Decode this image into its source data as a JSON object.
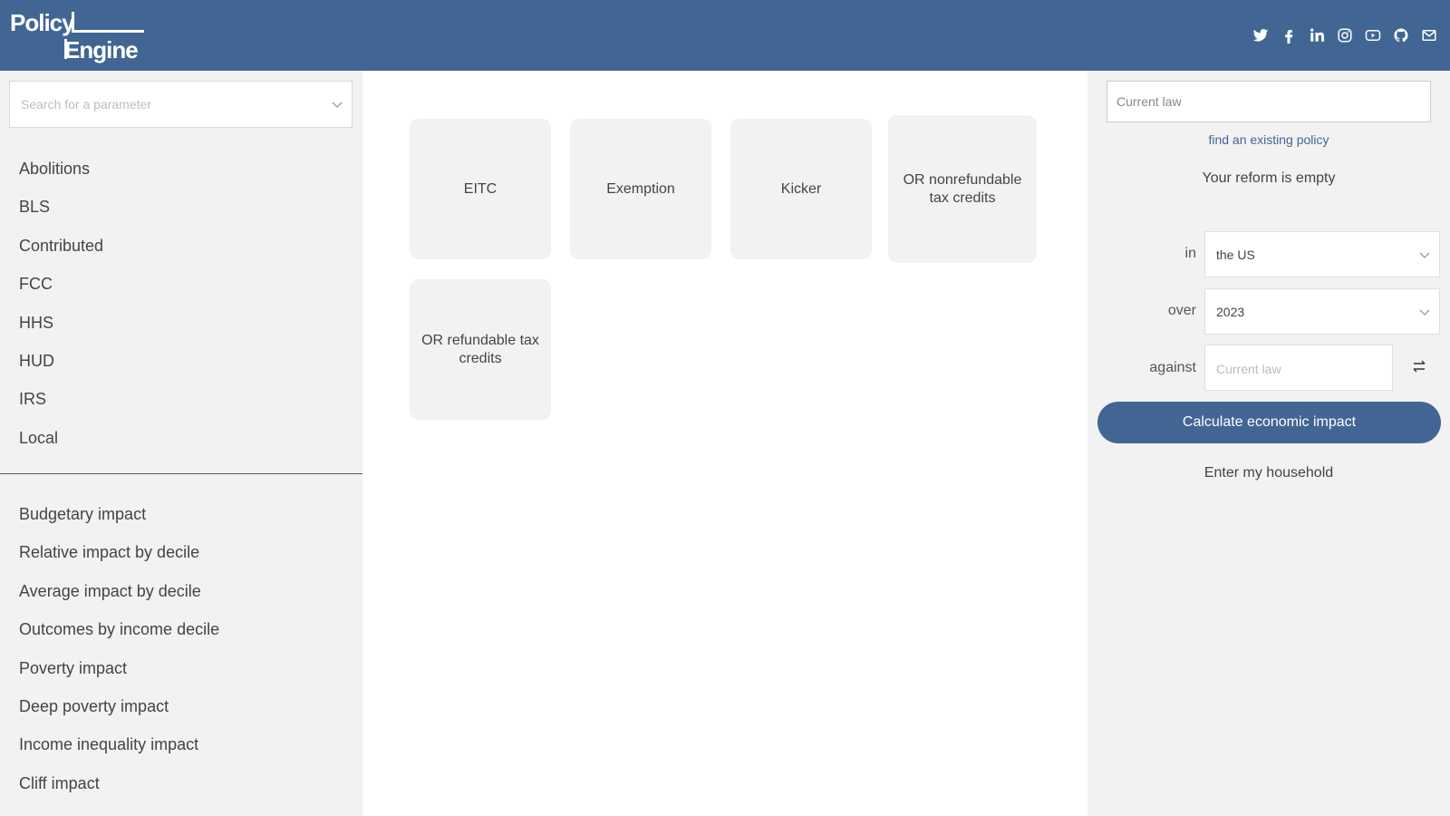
{
  "header": {
    "logo_line1": "Policy",
    "logo_line2": "Engine",
    "social_icons": [
      "twitter-icon",
      "facebook-icon",
      "linkedin-icon",
      "instagram-icon",
      "youtube-icon",
      "github-icon",
      "mail-icon"
    ],
    "background_color": "#426693"
  },
  "sidebar": {
    "search_placeholder": "Search for a parameter",
    "parameter_groups": [
      "Abolitions",
      "BLS",
      "Contributed",
      "FCC",
      "HHS",
      "HUD",
      "IRS",
      "Local"
    ],
    "outputs": [
      "Budgetary impact",
      "Relative impact by decile",
      "Average impact by decile",
      "Outcomes by income decile",
      "Poverty impact",
      "Deep poverty impact",
      "Income inequality impact",
      "Cliff impact"
    ]
  },
  "main": {
    "cards": [
      "EITC",
      "Exemption",
      "Kicker",
      "OR nonrefundable tax credits",
      "OR refundable tax credits"
    ]
  },
  "reform_panel": {
    "policy_name": "Current law",
    "find_link": "find an existing policy",
    "empty_message": "Your reform is empty",
    "in_label": "in",
    "region_value": "the US",
    "over_label": "over",
    "year_value": "2023",
    "against_label": "against",
    "against_placeholder": "Current law",
    "calculate_label": "Calculate economic impact",
    "household_label": "Enter my household",
    "accent_color": "#426693"
  }
}
